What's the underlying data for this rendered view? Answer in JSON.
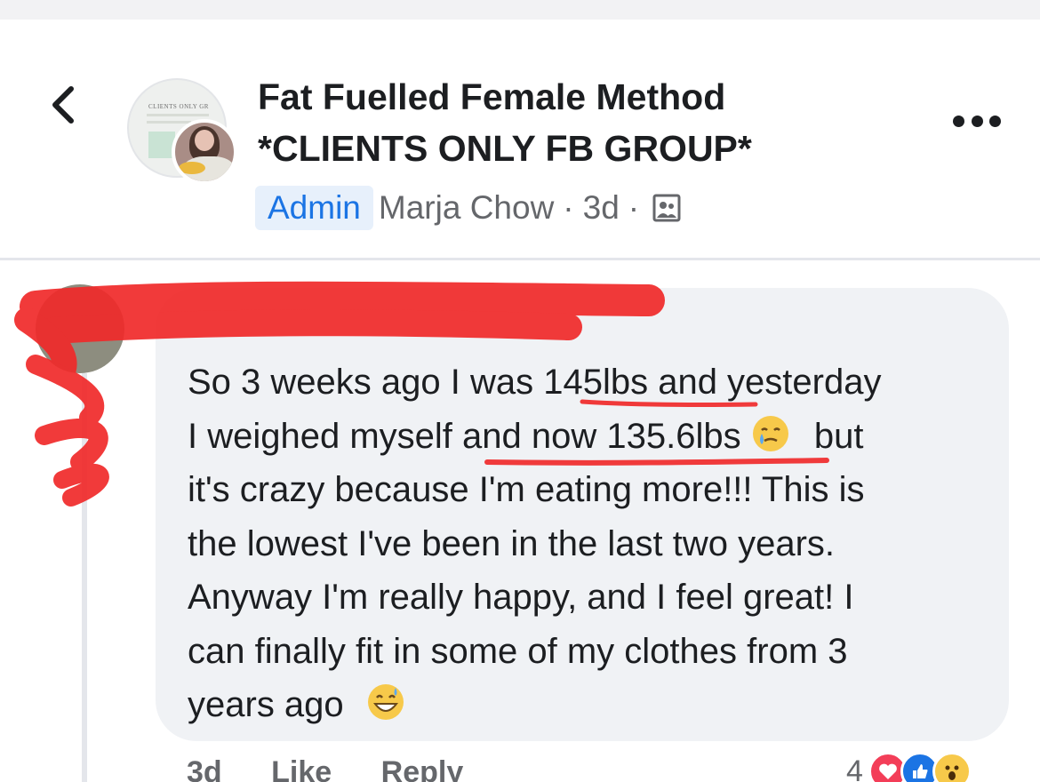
{
  "header": {
    "group_title_line1": "Fat Fuelled Female Method",
    "group_title_line2": "*CLIENTS ONLY FB GROUP*",
    "avatar_text": "CLIENTS ONLY GR",
    "badge": "Admin",
    "author": "Marja Chow",
    "time": "3d",
    "separator": "·",
    "privacy_icon": "members-group-icon",
    "back_icon": "chevron-left-icon",
    "more_icon": "more-horizontal-icon"
  },
  "comment": {
    "author": "",
    "lines": [
      "So 3 weeks ago I was 145lbs and yesterday",
      "I weighed myself and now 135.6lbs",
      "but",
      "it's crazy because I'm eating more!!! This is",
      "the lowest I've been in the last two years.",
      "Anyway I'm really happy, and I feel great! I",
      "can finally fit in some of my clothes from 3",
      "years ago"
    ],
    "emoji_1": "crying-smile-emoji",
    "emoji_2": "grin-sweat-emoji"
  },
  "actions": {
    "time": "3d",
    "like_label": "Like",
    "reply_label": "Reply",
    "reaction_count": "4",
    "reaction_icons": [
      "love-reaction-icon",
      "like-reaction-icon",
      "wow-reaction-icon"
    ]
  },
  "colors": {
    "accent": "#1b74e4",
    "bubble": "#f0f2f5",
    "redaction": "#f02a2a"
  }
}
